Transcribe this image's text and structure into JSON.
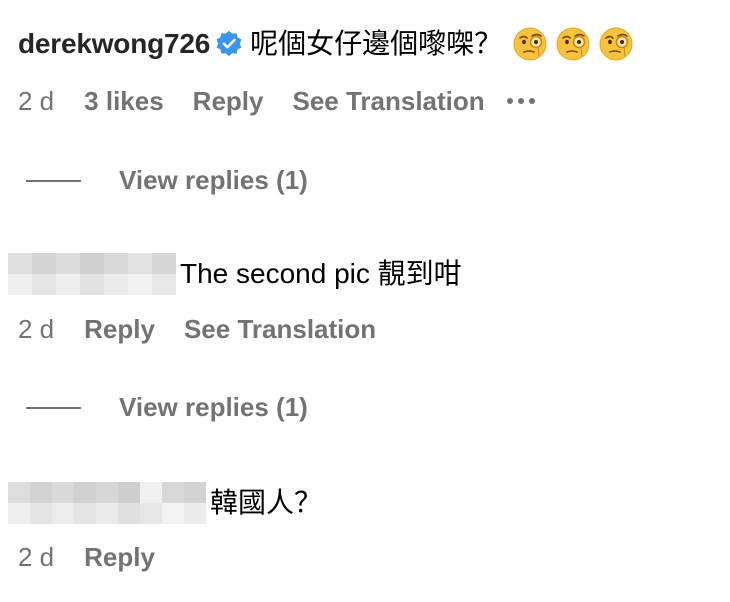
{
  "comments": [
    {
      "username": "derekwong726",
      "verified": true,
      "text": "呢個女仔邊個嚟㗎？",
      "emojis": [
        "face-with-monocle",
        "face-with-monocle",
        "face-with-monocle"
      ],
      "time": "2 d",
      "likes": "3 likes",
      "reply": "Reply",
      "translate": "See Translation",
      "more": "more-icon",
      "view_replies": "View replies (1)"
    },
    {
      "username_blurred": true,
      "text": "The second pic 靚到咁",
      "time": "2 d",
      "reply": "Reply",
      "translate": "See Translation",
      "view_replies": "View replies (1)"
    },
    {
      "username_blurred": true,
      "text": "韓國人？",
      "time": "2 d",
      "reply": "Reply"
    }
  ],
  "colors": {
    "username": "#262626",
    "meta": "#737373",
    "verified": "#3797f0"
  }
}
